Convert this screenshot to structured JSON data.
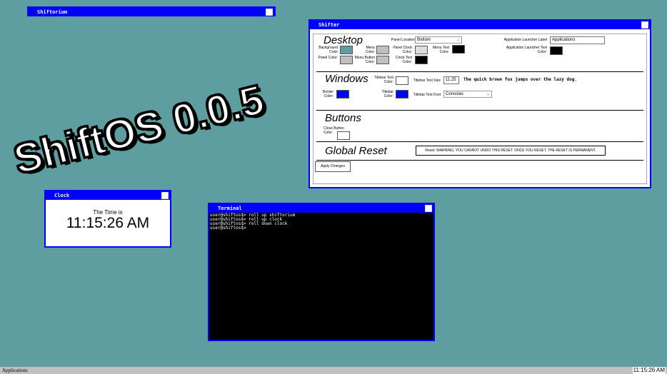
{
  "desktop": {
    "background": "#5f9ea0"
  },
  "banner": {
    "text": "ShiftOS 0.0.5"
  },
  "shiftorium": {
    "title": "Shiftorium"
  },
  "shifter": {
    "title": "Shifter",
    "desktop": {
      "heading": "Desktop",
      "panel_location_label": "Panel Location",
      "panel_location_value": "Bottom",
      "background_color_label": "Background Color",
      "background_color": "#5f9ea0",
      "menu_color_label": "Menu Color:",
      "panel_clock_color_label": "Panel Clock Color:",
      "menu_text_color_label": "Menu Text Color:",
      "panel_color_label": "Panel Color:",
      "menu_button_color_label": "Menu Button Color:",
      "clock_text_color_label": "Clock Text Color:",
      "launcher_label_label": "Application Launcher Label",
      "launcher_label_value": "Applications",
      "launcher_text_color_label": "Application Launcher Text Color:"
    },
    "windows": {
      "heading": "Windows",
      "titlebar_text_color_label": "Titlebar Text Color:",
      "titlebar_text_size_label": "Titlebar Text Size",
      "titlebar_text_size_value": "11.25",
      "preview_text": "The quick brown fox jumps over the lazy dog.",
      "border_color_label": "Border Color:",
      "titlebar_color_label": "Titlebar Color:",
      "titlebar_text_font_label": "Titlebar Text Font",
      "titlebar_text_font_value": "Consolas"
    },
    "buttons": {
      "heading": "Buttons",
      "close_button_color_label": "Close Button Color:"
    },
    "reset": {
      "heading": "Global Reset",
      "reset_button_text": "Reset: WARNING, YOU CANNOT UNDO THIS RESET. ONCE YOU RESET, THE RESET IS PERMANENT."
    },
    "apply_label": "Apply Changes"
  },
  "clock_window": {
    "title": "Clock",
    "caption": "The Time is",
    "time": "11:15:26 AM"
  },
  "terminal": {
    "title": "Terminal",
    "lines": [
      "user@shiftos$> roll up shiftorium",
      "user@shiftos$> roll up clock",
      "user@shiftos$> roll down clock",
      "user@shiftos$>"
    ]
  },
  "taskbar": {
    "launcher": "Applications",
    "clock": "11:15:26 AM"
  }
}
